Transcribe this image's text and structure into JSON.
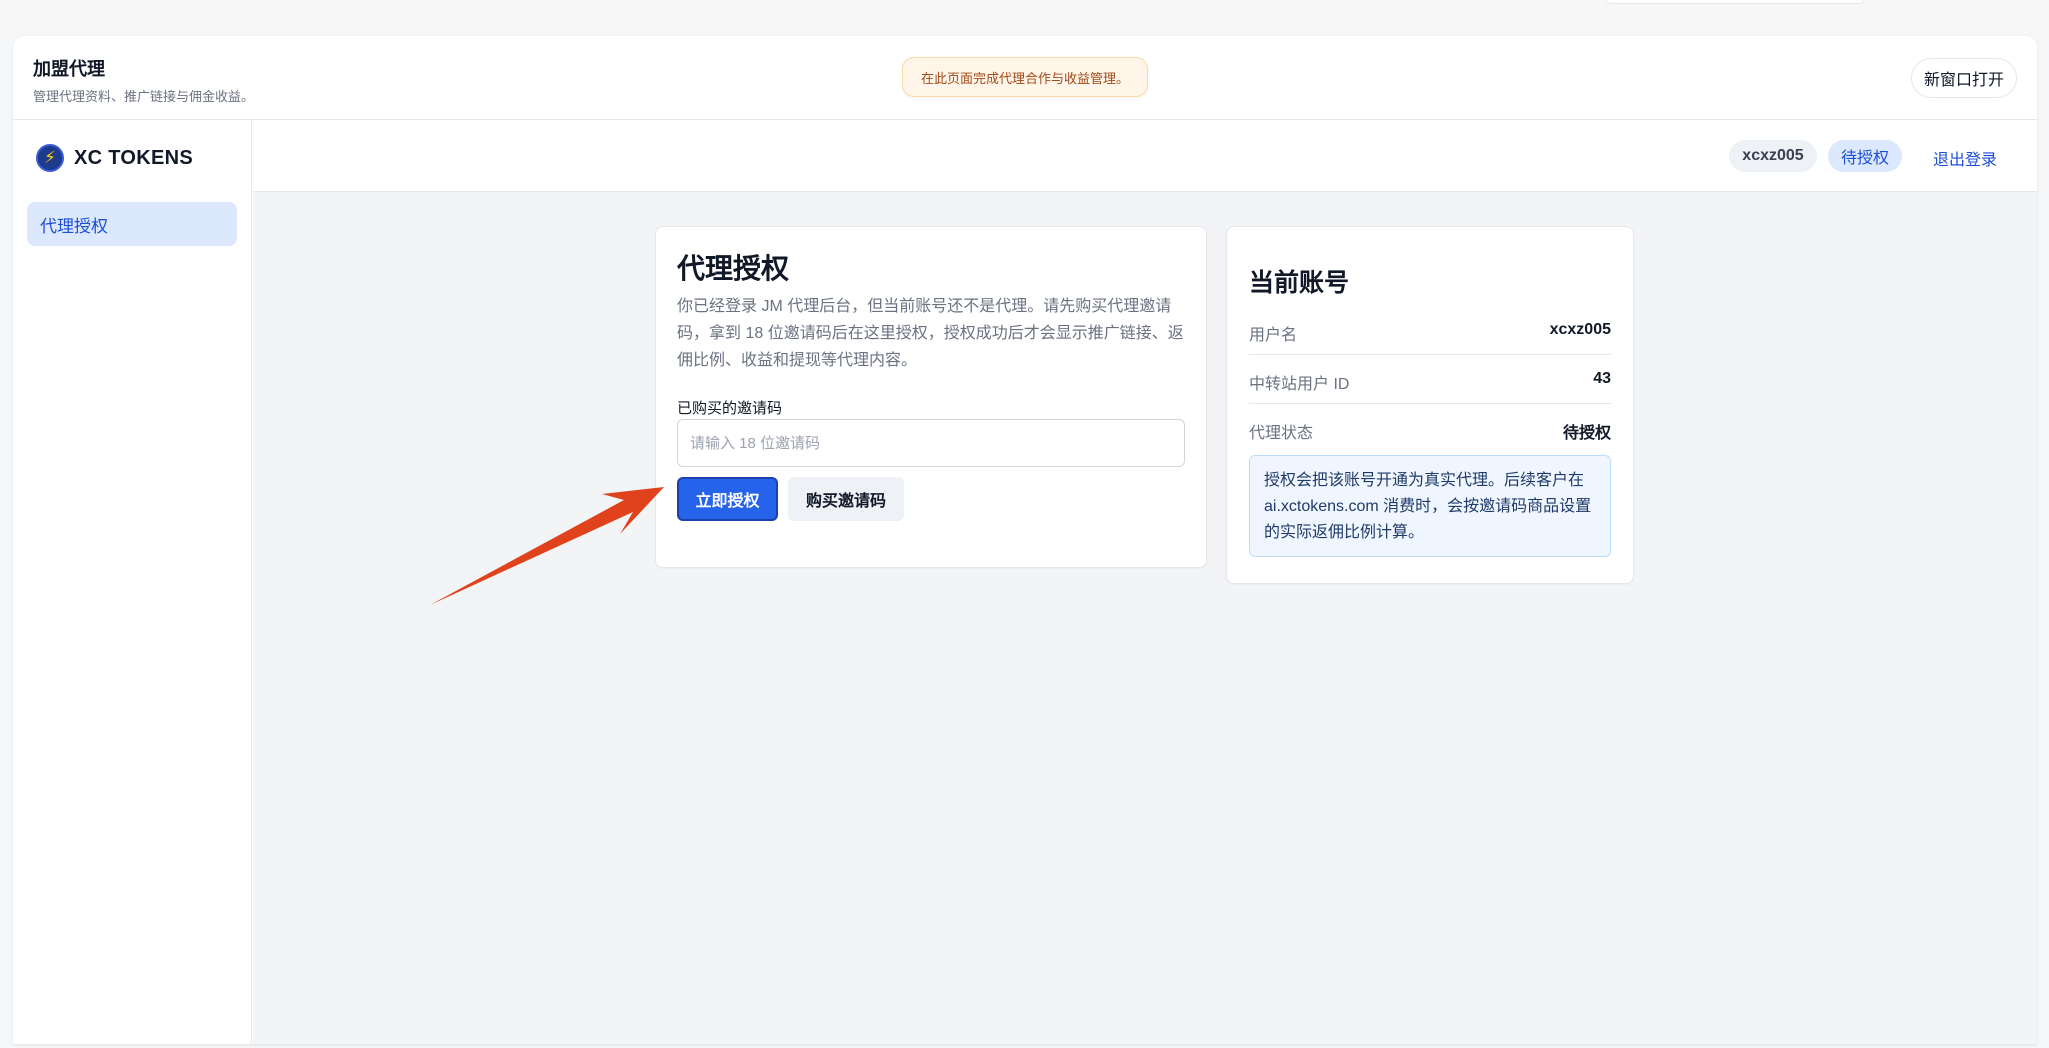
{
  "panel": {
    "title": "加盟代理",
    "subtitle": "管理代理资料、推广链接与佣金收益。",
    "notice": "在此页面完成代理合作与收益管理。",
    "open_new_window": "新窗口打开"
  },
  "sidebar": {
    "brand": "XC TOKENS",
    "items": [
      {
        "label": "代理授权",
        "active": true
      }
    ]
  },
  "topbar": {
    "username_chip": "xcxz005",
    "status_chip": "待授权",
    "logout": "退出登录"
  },
  "auth_card": {
    "title": "代理授权",
    "description": "你已经登录 JM 代理后台，但当前账号还不是代理。请先购买代理邀请码，拿到 18 位邀请码后在这里授权，授权成功后才会显示推广链接、返佣比例、收益和提现等代理内容。",
    "field_label": "已购买的邀请码",
    "input_value": "",
    "input_placeholder": "请输入 18 位邀请码",
    "primary_button": "立即授权",
    "secondary_button": "购买邀请码"
  },
  "account_card": {
    "title": "当前账号",
    "rows": [
      {
        "key": "用户名",
        "value": "xcxz005"
      },
      {
        "key": "中转站用户 ID",
        "value": "43"
      },
      {
        "key": "代理状态",
        "value": "待授权"
      }
    ],
    "info": "授权会把该账号开通为真实代理。后续客户在 ai.xctokens.com 消费时，会按邀请码商品设置的实际返佣比例计算。"
  },
  "colors": {
    "accent": "#2563eb",
    "arrow": "#e0421b",
    "notice_bg": "#fff5e8"
  }
}
